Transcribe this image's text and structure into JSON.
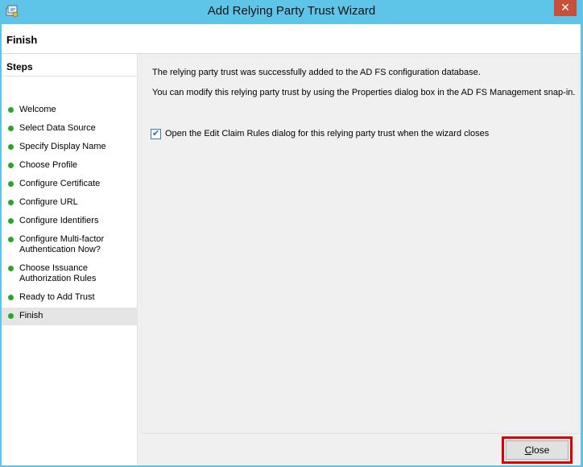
{
  "window": {
    "title": "Add Relying Party Trust Wizard",
    "close_glyph": "✕"
  },
  "page": {
    "title": "Finish"
  },
  "steps": {
    "heading": "Steps",
    "items": [
      {
        "label": "Welcome"
      },
      {
        "label": "Select Data Source"
      },
      {
        "label": "Specify Display Name"
      },
      {
        "label": "Choose Profile"
      },
      {
        "label": "Configure Certificate"
      },
      {
        "label": "Configure URL"
      },
      {
        "label": "Configure Identifiers"
      },
      {
        "label_line1": "Configure Multi-factor",
        "label_line2": "Authentication Now?"
      },
      {
        "label_line1": "Choose Issuance",
        "label_line2": "Authorization Rules"
      },
      {
        "label": "Ready to Add Trust"
      },
      {
        "label": "Finish"
      }
    ],
    "status_color": "#27a627"
  },
  "content": {
    "success_message": "The relying party trust was successfully added to the AD FS configuration database.",
    "modify_message": "You can modify this relying party trust by using the Properties dialog box in the AD FS Management snap-in.",
    "edit_claim_rules": {
      "label": "Open the Edit Claim Rules dialog for this relying party trust when the wizard closes",
      "checked": true
    }
  },
  "footer": {
    "close_button": {
      "accel": "C",
      "rest": "lose"
    },
    "highlight_color": "#e00000"
  }
}
